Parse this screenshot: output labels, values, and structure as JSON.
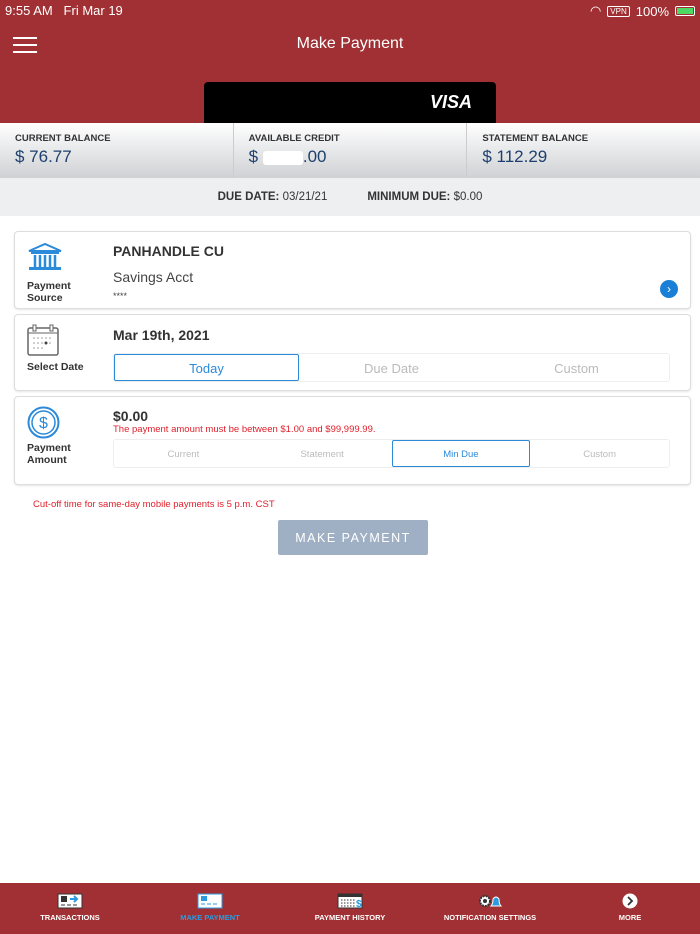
{
  "status": {
    "time": "9:55 AM",
    "date": "Fri Mar 19",
    "vpn": "VPN",
    "battery": "100%"
  },
  "header": {
    "title": "Make Payment",
    "card_brand": "VISA"
  },
  "balances": [
    {
      "label": "CURRENT BALANCE",
      "value": "$ 76.77"
    },
    {
      "label": "AVAILABLE CREDIT",
      "prefix": "$",
      "suffix": ".00"
    },
    {
      "label": "STATEMENT BALANCE",
      "value": "$ 112.29"
    }
  ],
  "due": {
    "date_label": "DUE DATE:",
    "date": "03/21/21",
    "min_label": "MINIMUM DUE:",
    "min": "$0.00"
  },
  "source": {
    "label1": "Payment",
    "label2": "Source",
    "name": "PANHANDLE CU",
    "account": "Savings Acct",
    "mask": "****"
  },
  "date": {
    "label": "Select Date",
    "value": "Mar 19th, 2021",
    "options": [
      "Today",
      "Due Date",
      "Custom"
    ]
  },
  "amount": {
    "label1": "Payment",
    "label2": "Amount",
    "value": "$0.00",
    "error": "The payment amount must be between $1.00 and $99,999.99.",
    "options": [
      "Current",
      "Statement",
      "Min Due",
      "Custom"
    ]
  },
  "cutoff": "Cut-off time for same-day mobile payments is 5 p.m. CST",
  "submit": "MAKE PAYMENT",
  "nav": [
    "TRANSACTIONS",
    "MAKE PAYMENT",
    "PAYMENT HISTORY",
    "NOTIFICATION SETTINGS",
    "MORE"
  ],
  "colors": {
    "brand": "#a03033",
    "accent": "#2b8ad9",
    "error": "#e0202c"
  }
}
